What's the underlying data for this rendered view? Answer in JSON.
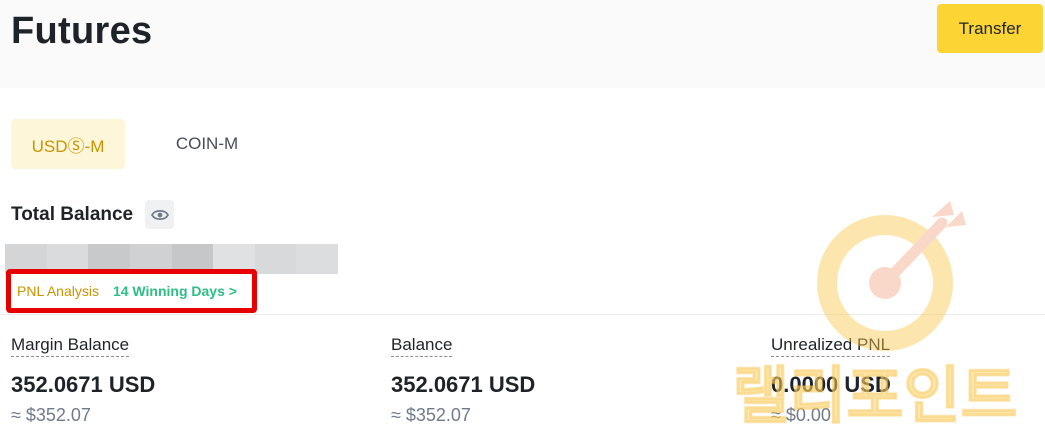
{
  "header": {
    "title": "Futures",
    "transfer_label": "Transfer"
  },
  "tabs": [
    {
      "label": "USDⓈ-M",
      "active": true
    },
    {
      "label": "COIN-M",
      "active": false
    }
  ],
  "balance": {
    "title": "Total Balance",
    "visibility_icon": "eye-icon",
    "value_hidden": true
  },
  "pnl": {
    "label": "PNL Analysis",
    "winning_days": "14 Winning Days >"
  },
  "stats": [
    {
      "label": "Margin Balance",
      "value": "352.0671 USD",
      "approx": "≈ $352.07"
    },
    {
      "label": "Balance",
      "value": "352.0671 USD",
      "approx": "≈ $352.07"
    },
    {
      "label": "Unrealized PNL",
      "value": "0.0000 USD",
      "approx": "≈ $0.00"
    }
  ],
  "watermark": {
    "text": "랠리포인트",
    "icon": "target-arrow-icon"
  },
  "colors": {
    "accent": "#fcd535",
    "accent_text": "#c99400",
    "positive": "#2ebd85",
    "highlight_border": "#e60000",
    "watermark": "#fcd36a"
  }
}
